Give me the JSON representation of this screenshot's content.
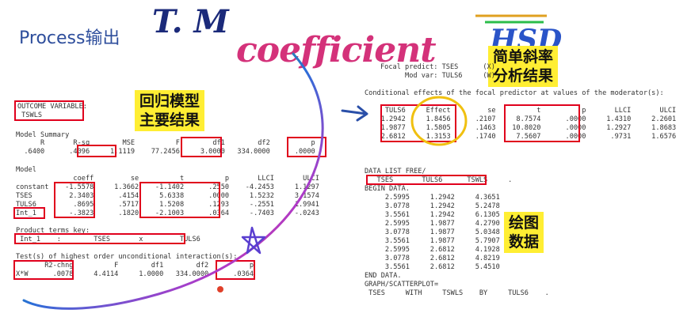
{
  "title": "Process输出",
  "handwriting": {
    "tm": "T. M",
    "coefficient": "coefficient",
    "hsd": "HSD"
  },
  "notes": {
    "regression": [
      "回归模型",
      "主要结果"
    ],
    "slope": [
      "简单斜率",
      "分析结果"
    ],
    "plot": [
      "绘图",
      "数据"
    ]
  },
  "left": {
    "outcome_label": "OUTCOME VARIABLE:",
    "outcome_value": " TSWLS",
    "model_summary_label": "Model Summary",
    "summary_header": "      R       R-sq        MSE          F        df1        df2          p",
    "summary_row": "  .6400      .4096     1.1119    77.2456     3.0000   334.0000      .0000",
    "model_label": "Model",
    "model_header": "              coeff         se          t          p       LLCI       ULCI",
    "model_rows": [
      "constant    -1.5578     1.3662    -1.1402      .2550    -4.2453     1.1297",
      "TSES         2.3403      .4154     5.6338      .0000     1.5232     3.1574",
      "TULS6         .8695      .5717     1.5208      .1293     -.2551     1.9941",
      "Int_1        -.3823      .1820    -2.1003      .0364     -.7403     -.0243"
    ],
    "product_label": "Product terms key:",
    "product_row": " Int_1    :        TSES       x         TULS6",
    "test_label": "Test(s) of highest order unconditional interaction(s):",
    "test_header": "       R2-chng          F        df1        df2          p",
    "test_row": "X*W      .0078     4.4114     1.0000   334.0000      .0364"
  },
  "right": {
    "focal": "Focal predict: TSES      (X)",
    "mod": "      Mod var: TULS6     (W)",
    "cond_label": "Conditional effects of the focal predictor at values of the moderator(s):",
    "cond_header": "     TULS6     Effect         se          t          p       LLCI       ULCI",
    "cond_rows": [
      "    1.2942     1.8456      .2107     8.7574      .0000     1.4310     2.2601",
      "    1.9877     1.5805      .1463    10.8020      .0000     1.2927     1.8683",
      "    2.6812     1.3153      .1740     7.5607      .0000      .9731     1.6576"
    ],
    "datalist": "DATA LIST FREE/",
    "datalist_vars": "   TSES       TULS6      TSWLS     .",
    "begin": "BEGIN DATA.",
    "data_rows": [
      "     2.5995     1.2942     4.3651",
      "     3.0778     1.2942     5.2478",
      "     3.5561     1.2942     6.1305",
      "     2.5995     1.9877     4.2790",
      "     3.0778     1.9877     5.0348",
      "     3.5561     1.9877     5.7907",
      "     2.5995     2.6812     4.1928",
      "     3.0778     2.6812     4.8219",
      "     3.5561     2.6812     5.4510"
    ],
    "end": "END DATA.",
    "graph": "GRAPH/SCATTERPLOT=",
    "graph_row": " TSES     WITH     TSWLS    BY     TULS6    ."
  }
}
